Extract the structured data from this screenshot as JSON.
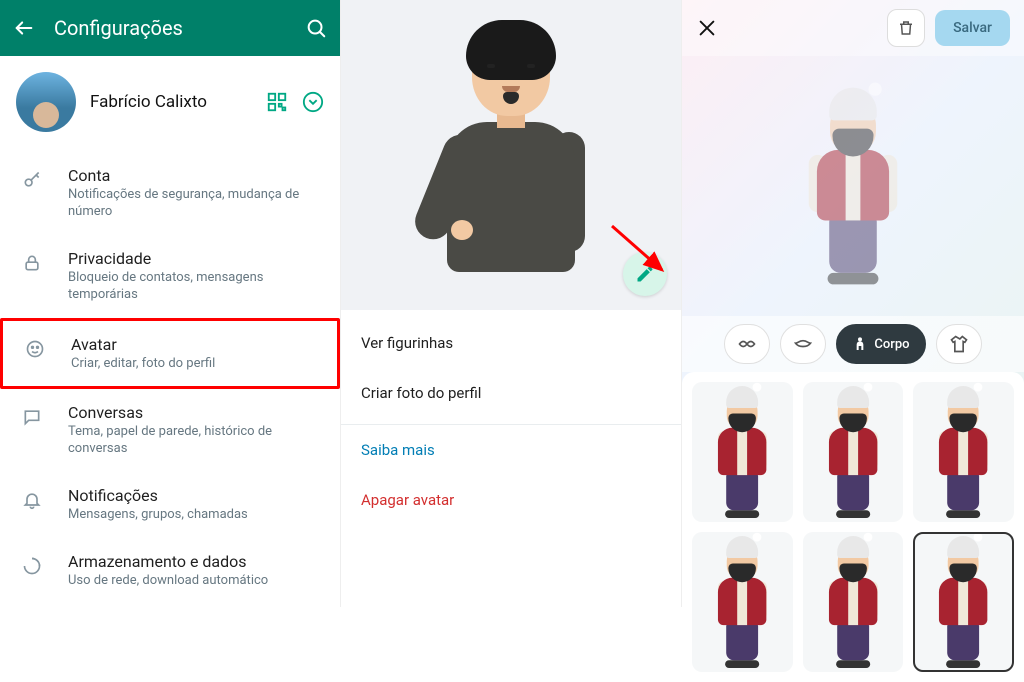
{
  "panel1": {
    "title": "Configurações",
    "profile_name": "Fabrício Calixto",
    "items": [
      {
        "key": "account",
        "title": "Conta",
        "desc": "Notificações de segurança, mudança de número"
      },
      {
        "key": "privacy",
        "title": "Privacidade",
        "desc": "Bloqueio de contatos, mensagens temporárias"
      },
      {
        "key": "avatar",
        "title": "Avatar",
        "desc": "Criar, editar, foto do perfil",
        "highlight": true
      },
      {
        "key": "chats",
        "title": "Conversas",
        "desc": "Tema, papel de parede, histórico de conversas"
      },
      {
        "key": "notifications",
        "title": "Notificações",
        "desc": "Mensagens, grupos, chamadas"
      },
      {
        "key": "storage",
        "title": "Armazenamento e dados",
        "desc": "Uso de rede, download automático"
      }
    ]
  },
  "panel2": {
    "view_stickers": "Ver figurinhas",
    "create_photo": "Criar foto do perfil",
    "learn_more": "Saiba mais",
    "delete_avatar": "Apagar avatar"
  },
  "panel3": {
    "save_label": "Salvar",
    "category_active_label": "Corpo"
  }
}
